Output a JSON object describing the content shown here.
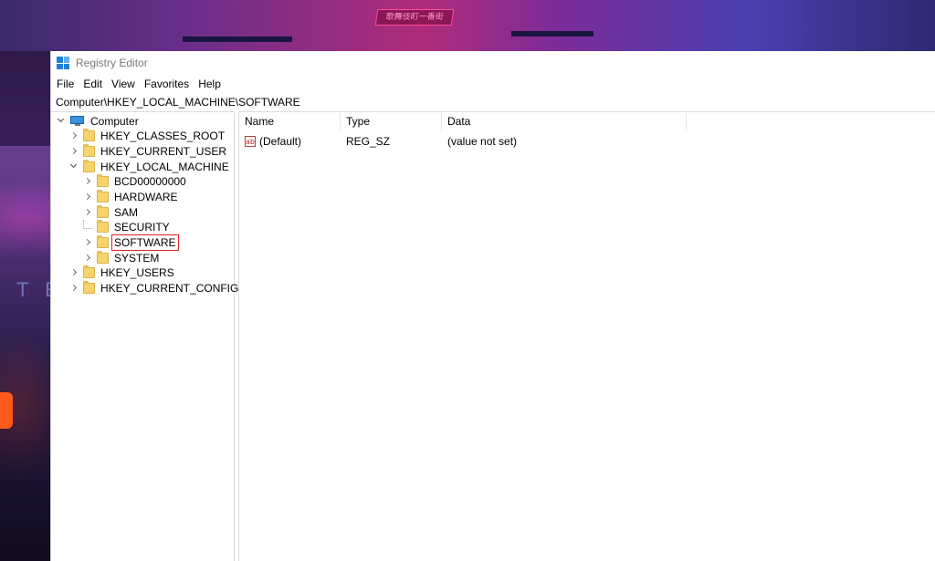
{
  "window": {
    "title": "Registry Editor",
    "address": "Computer\\HKEY_LOCAL_MACHINE\\SOFTWARE"
  },
  "menu": [
    "File",
    "Edit",
    "View",
    "Favorites",
    "Help"
  ],
  "tree": {
    "root": "Computer",
    "hives": [
      "HKEY_CLASSES_ROOT",
      "HKEY_CURRENT_USER",
      "HKEY_LOCAL_MACHINE",
      "HKEY_USERS",
      "HKEY_CURRENT_CONFIG"
    ],
    "hklm_children": [
      "BCD00000000",
      "HARDWARE",
      "SAM",
      "SECURITY",
      "SOFTWARE",
      "SYSTEM"
    ],
    "selected": "SOFTWARE"
  },
  "list": {
    "headers": [
      "Name",
      "Type",
      "Data"
    ],
    "rows": [
      {
        "name": "(Default)",
        "type": "REG_SZ",
        "data": "(value not set)",
        "icon": "string-value-icon"
      }
    ]
  },
  "wallpaper": {
    "sign_text": "歌舞伎町一番街",
    "panel_text": "T E"
  },
  "colors": {
    "highlight": "#e0202a",
    "folder": "#f6d36b",
    "accent": "#1f7fd6"
  }
}
